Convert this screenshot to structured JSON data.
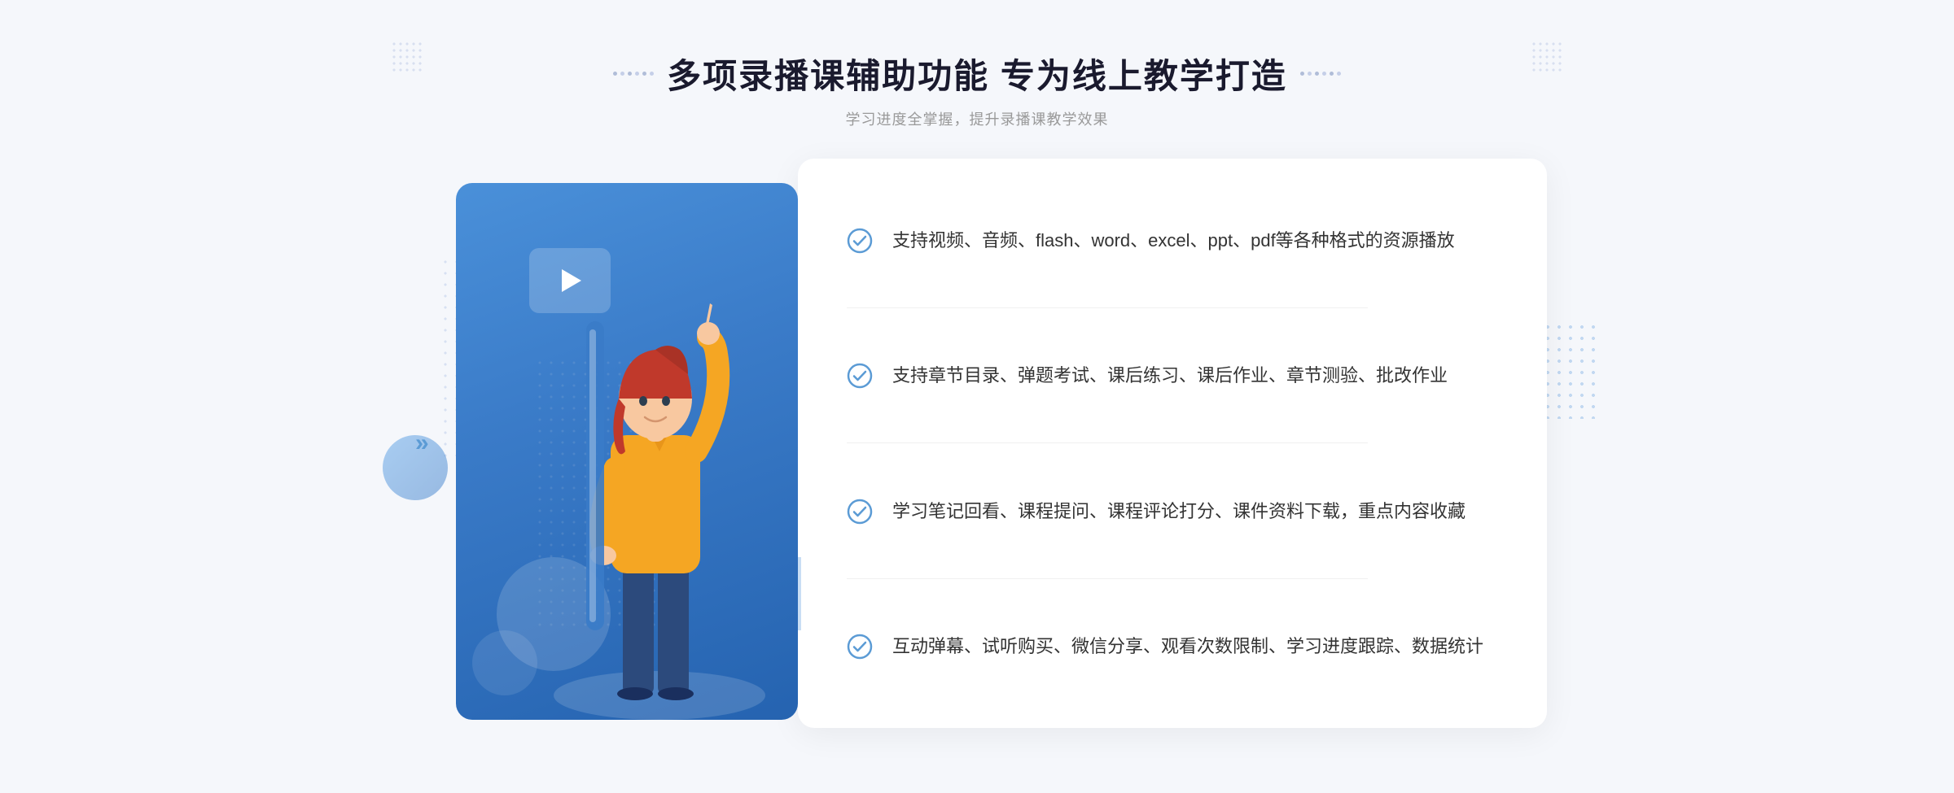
{
  "header": {
    "title": "多项录播课辅助功能 专为线上教学打造",
    "subtitle": "学习进度全掌握，提升录播课教学效果"
  },
  "features": [
    {
      "id": "feature-1",
      "text": "支持视频、音频、flash、word、excel、ppt、pdf等各种格式的资源播放"
    },
    {
      "id": "feature-2",
      "text": "支持章节目录、弹题考试、课后练习、课后作业、章节测验、批改作业"
    },
    {
      "id": "feature-3",
      "text": "学习笔记回看、课程提问、课程评论打分、课件资料下载，重点内容收藏"
    },
    {
      "id": "feature-4",
      "text": "互动弹幕、试听购买、微信分享、观看次数限制、学习进度跟踪、数据统计"
    }
  ],
  "icons": {
    "check": "check-circle-icon",
    "play": "play-icon",
    "arrows_left": "«"
  },
  "colors": {
    "blue_primary": "#3a7bc8",
    "blue_light": "#4a90d9",
    "text_dark": "#1a1a2e",
    "text_gray": "#999999",
    "text_body": "#333333",
    "white": "#ffffff",
    "check_color": "#5b9bd5"
  }
}
